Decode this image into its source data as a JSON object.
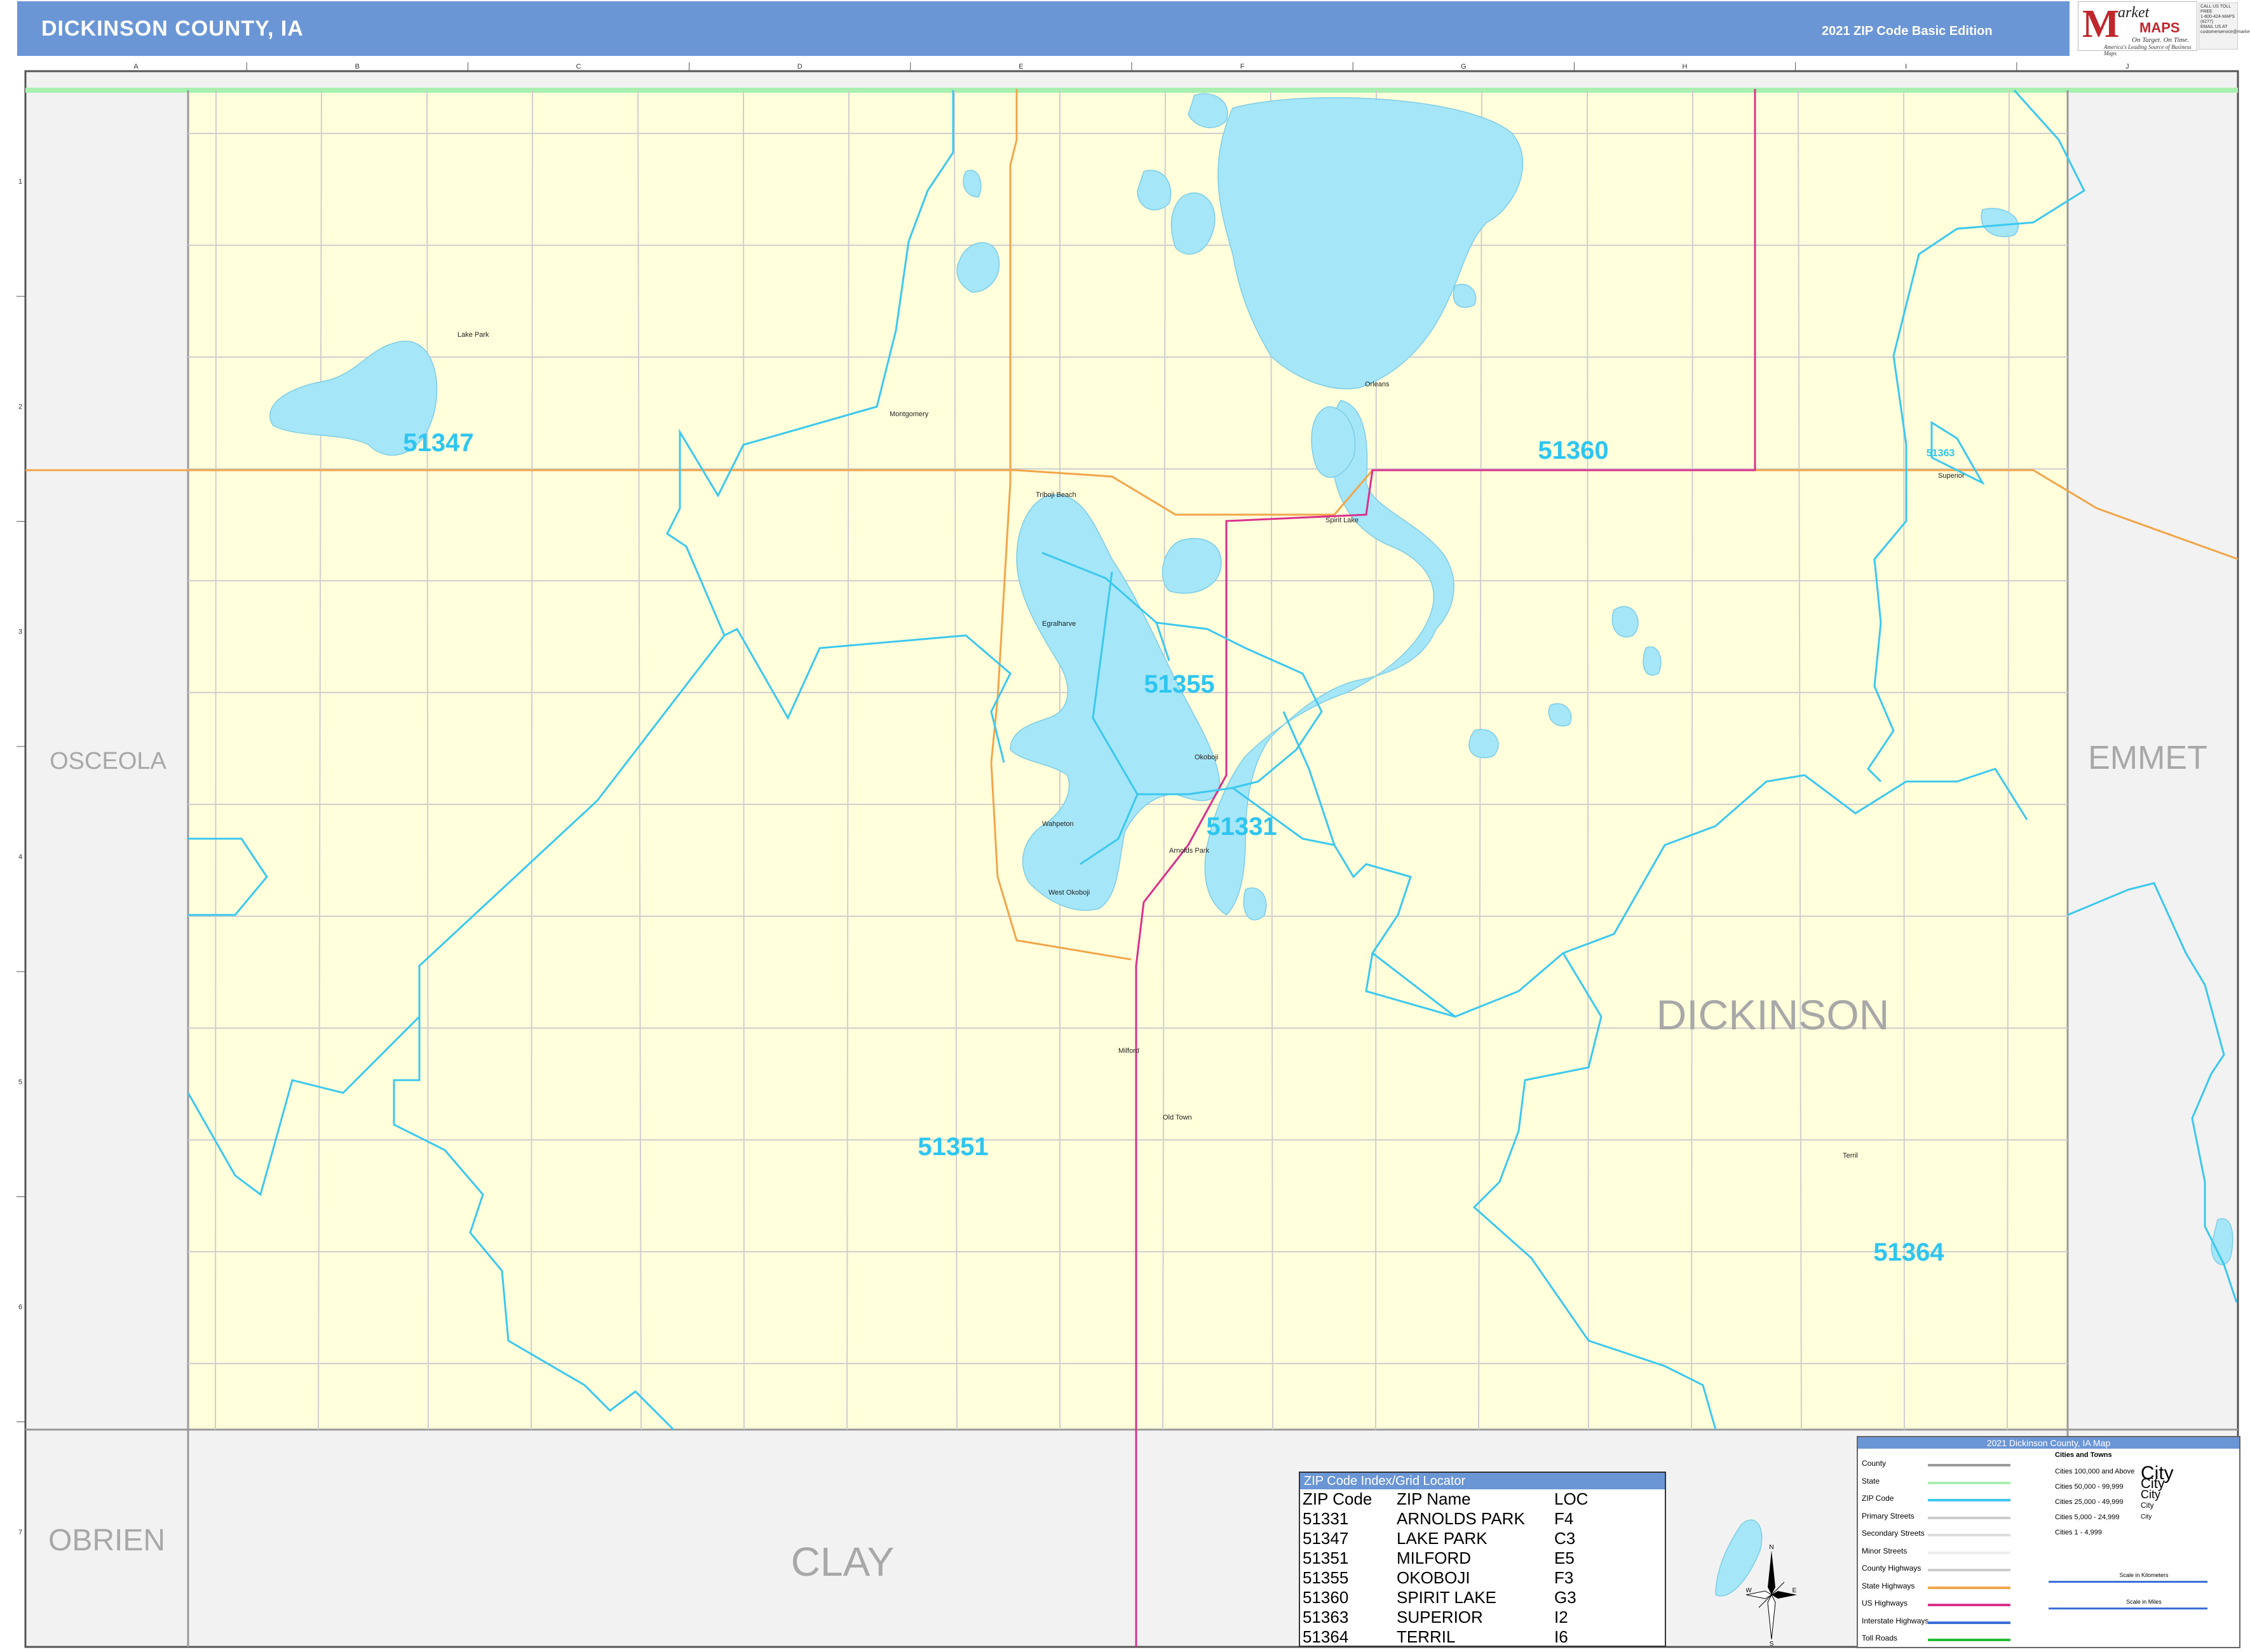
{
  "header": {
    "title": "DICKINSON COUNTY, IA",
    "edition": "2021 ZIP Code Basic Edition"
  },
  "logo": {
    "m": "M",
    "arket": "arket",
    "maps": "MAPS",
    "tagline1": "On Target. On Time.",
    "tagline2": "America's Leading Source of Business Maps",
    "contact": "CALL US TOLL FREE\n1-800-424-MAPS (6277)\nEMAIL US AT\ncustomerservice@marketmaps.com"
  },
  "grid": {
    "columns": [
      "A",
      "B",
      "C",
      "D",
      "E",
      "F",
      "G",
      "H",
      "I",
      "J"
    ],
    "rows": [
      "1",
      "2",
      "3",
      "4",
      "5",
      "6",
      "7"
    ]
  },
  "counties": {
    "osceola": "OSCEOLA",
    "emmet": "EMMET",
    "dickinson": "DICKINSON",
    "obrien": "OBRIEN",
    "clay": "CLAY"
  },
  "zip_labels": [
    {
      "zip": "51347"
    },
    {
      "zip": "51360"
    },
    {
      "zip": "51355"
    },
    {
      "zip": "51331"
    },
    {
      "zip": "51351"
    },
    {
      "zip": "51364"
    },
    {
      "zip": "51363"
    }
  ],
  "places": [
    {
      "name": "Lake Park"
    },
    {
      "name": "Montgomery"
    },
    {
      "name": "Orleans"
    },
    {
      "name": "Triboji Beach"
    },
    {
      "name": "Spirit Lake"
    },
    {
      "name": "Superior"
    },
    {
      "name": "Egralharve"
    },
    {
      "name": "Okoboji"
    },
    {
      "name": "Wahpeton"
    },
    {
      "name": "Arnolds Park"
    },
    {
      "name": "West Okoboji"
    },
    {
      "name": "Milford"
    },
    {
      "name": "Old Town"
    },
    {
      "name": "Terril"
    }
  ],
  "zip_index": {
    "title": "ZIP Code Index/Grid Locator",
    "headers": [
      "ZIP Code",
      "ZIP Name",
      "LOC"
    ],
    "rows": [
      [
        "51331",
        "ARNOLDS PARK",
        "F4"
      ],
      [
        "51347",
        "LAKE PARK",
        "C3"
      ],
      [
        "51351",
        "MILFORD",
        "E5"
      ],
      [
        "51355",
        "OKOBOJI",
        "F3"
      ],
      [
        "51360",
        "SPIRIT LAKE",
        "G3"
      ],
      [
        "51363",
        "SUPERIOR",
        "I2"
      ],
      [
        "51364",
        "TERRIL",
        "I6"
      ]
    ]
  },
  "legend": {
    "title": "2021 Dickinson County, IA Map",
    "items": [
      {
        "label": "County",
        "color": "#9a9a9a"
      },
      {
        "label": "State",
        "color": "#a8f0b0"
      },
      {
        "label": "ZIP Code",
        "color": "#3cc8ee"
      },
      {
        "label": "Primary Streets",
        "color": "#cccccc"
      },
      {
        "label": "Secondary Streets",
        "color": "#dddddd"
      },
      {
        "label": "Minor Streets",
        "color": "#eeeeee"
      },
      {
        "label": "County Highways",
        "color": "#cccccc"
      },
      {
        "label": "State Highways",
        "color": "#f2a54a"
      },
      {
        "label": "US Highways",
        "color": "#d9318c"
      },
      {
        "label": "Interstate Highways",
        "color": "#3a6fd8"
      },
      {
        "label": "Toll Roads",
        "color": "#22bb33"
      }
    ],
    "cities_title": "Cities and Towns",
    "cities": [
      {
        "label": "Cities 100,000 and Above",
        "example": "City"
      },
      {
        "label": "Cities 50,000 - 99,999",
        "example": "City"
      },
      {
        "label": "Cities 25,000 - 49,999",
        "example": "City"
      },
      {
        "label": "Cities 5,000 - 24,999",
        "example": "City"
      },
      {
        "label": "Cities 1 - 4,999",
        "example": "City"
      }
    ],
    "scale_km": "Scale in Kilometers",
    "scale_mi": "Scale in Miles"
  },
  "compass": {
    "n": "N",
    "s": "S",
    "e": "E",
    "w": "W"
  },
  "colors": {
    "county_fill": "#ffffdc",
    "neighbor_fill": "#f2f2f2",
    "water": "#a5e6f8",
    "zip_boundary": "#3cc8ee",
    "zip_label": "#2ec5f0",
    "county_label": "#a8a8a8",
    "state_highway": "#f2a54a",
    "us_highway": "#d9318c",
    "header": "#6b96d6"
  }
}
